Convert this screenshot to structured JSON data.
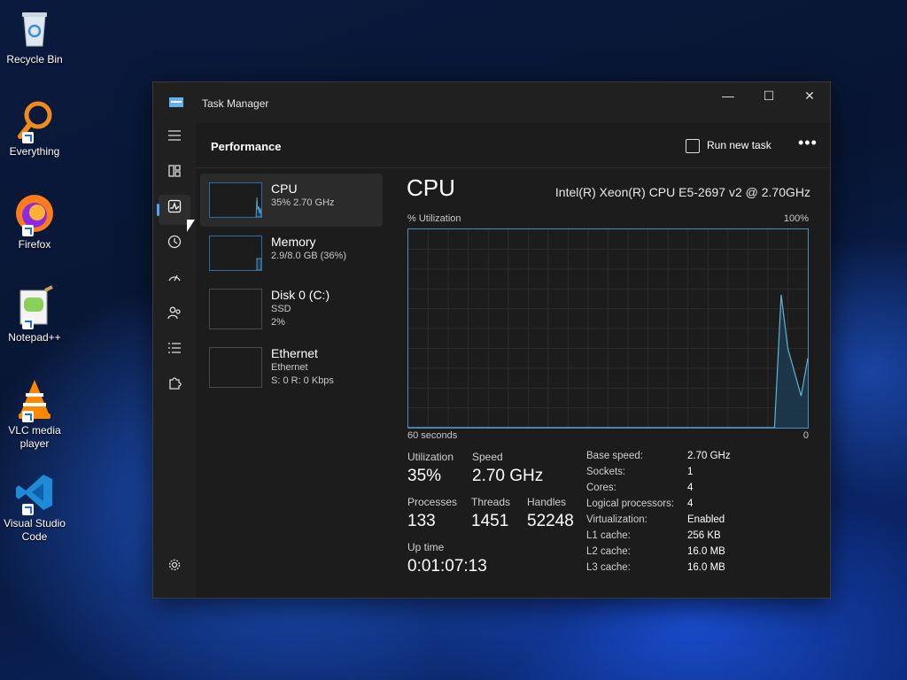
{
  "desktop": {
    "icons": [
      {
        "label": "Recycle Bin",
        "icon": "recycle-bin-icon"
      },
      {
        "label": "Everything",
        "icon": "everything-search-icon"
      },
      {
        "label": "Firefox",
        "icon": "firefox-icon"
      },
      {
        "label": "Notepad++",
        "icon": "notepadplusplus-icon"
      },
      {
        "label": "VLC media player",
        "icon": "vlc-icon"
      },
      {
        "label": "Visual Studio Code",
        "icon": "vscode-icon"
      }
    ]
  },
  "window": {
    "title": "Task Manager",
    "controls": {
      "minimize": "—",
      "maximize": "☐",
      "close": "✕"
    }
  },
  "nav": {
    "items": [
      "Menu",
      "Processes",
      "Performance",
      "App history",
      "Startup apps",
      "Users",
      "Details",
      "Services"
    ],
    "active": "Performance",
    "settings": "Settings"
  },
  "header": {
    "title": "Performance",
    "run_task": "Run new task",
    "more": "•••"
  },
  "resources": [
    {
      "name": "CPU",
      "line1": "35% 2.70 GHz"
    },
    {
      "name": "Memory",
      "line1": "2.9/8.0 GB (36%)"
    },
    {
      "name": "Disk 0 (C:)",
      "line1": "SSD",
      "line2": "2%"
    },
    {
      "name": "Ethernet",
      "line1": "Ethernet",
      "line2": "S: 0 R: 0 Kbps"
    }
  ],
  "detail": {
    "title": "CPU",
    "model": "Intel(R) Xeon(R) CPU E5-2697 v2 @ 2.70GHz",
    "graph": {
      "y_label": "% Utilization",
      "y_max": "100%",
      "x_label": "60 seconds",
      "x_min": "0",
      "line_color": "#5fb3d8",
      "fill_color": "#1e3a4c"
    },
    "stats": {
      "utilization_label": "Utilization",
      "utilization": "35%",
      "speed_label": "Speed",
      "speed": "2.70 GHz",
      "processes_label": "Processes",
      "processes": "133",
      "threads_label": "Threads",
      "threads": "1451",
      "handles_label": "Handles",
      "handles": "52248",
      "uptime_label": "Up time",
      "uptime": "0:01:07:13"
    },
    "specs": [
      {
        "label": "Base speed:",
        "value": "2.70 GHz"
      },
      {
        "label": "Sockets:",
        "value": "1"
      },
      {
        "label": "Cores:",
        "value": "4"
      },
      {
        "label": "Logical processors:",
        "value": "4"
      },
      {
        "label": "Virtualization:",
        "value": "Enabled"
      },
      {
        "label": "L1 cache:",
        "value": "256 KB"
      },
      {
        "label": "L2 cache:",
        "value": "16.0 MB"
      },
      {
        "label": "L3 cache:",
        "value": "16.0 MB"
      }
    ]
  },
  "chart_data": {
    "type": "area",
    "x": [
      0,
      1,
      2,
      3,
      4,
      5,
      6,
      7,
      8,
      9,
      10,
      11,
      12,
      13,
      14,
      15,
      16,
      17,
      18,
      19,
      20,
      21,
      22,
      23,
      24,
      25,
      26,
      27,
      28,
      29,
      30,
      31,
      32,
      33,
      34,
      35,
      36,
      37,
      38,
      39,
      40,
      41,
      42,
      43,
      44,
      45,
      46,
      47,
      48,
      49,
      50,
      51,
      52,
      53,
      54,
      55,
      56,
      57,
      58,
      59,
      60
    ],
    "values": [
      0,
      0,
      0,
      0,
      0,
      0,
      0,
      0,
      0,
      0,
      0,
      0,
      0,
      0,
      0,
      0,
      0,
      0,
      0,
      0,
      0,
      0,
      0,
      0,
      0,
      0,
      0,
      0,
      0,
      0,
      0,
      0,
      0,
      0,
      0,
      0,
      0,
      0,
      0,
      0,
      0,
      0,
      0,
      0,
      0,
      0,
      0,
      0,
      0,
      0,
      0,
      0,
      0,
      0,
      0,
      0,
      67,
      40,
      28,
      16,
      35
    ],
    "ylim": [
      0,
      100
    ],
    "xlim": [
      0,
      60
    ],
    "grid": true
  }
}
